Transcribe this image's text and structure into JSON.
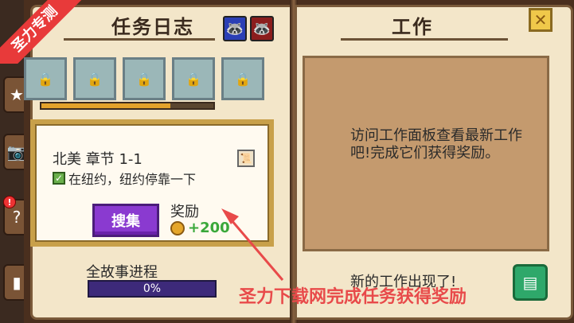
{
  "left_page": {
    "title": "任务日志",
    "portraits": [
      "blue-raccoon",
      "red-raccoon"
    ],
    "map_progress_percent": 75
  },
  "quest": {
    "title": "北美 章节 1-1",
    "task": "在纽约，纽约停靠一下",
    "collect_button": "搜集",
    "reward_label": "奖励",
    "reward_value": "+200"
  },
  "story_progress": {
    "label": "全故事进程",
    "value": "0%"
  },
  "right_page": {
    "title": "工作",
    "message": "访问工作面板查看最新工作吧!完成它们获得奖励。",
    "new_work": "新的工作出现了!"
  },
  "watermark": {
    "corner": "圣力专测",
    "caption": "圣力下载网完成任务获得奖励"
  },
  "colors": {
    "collect_button": "#8a3ad0",
    "reward_text": "#3aa83a",
    "story_bar": "#3d2a7a",
    "watermark": "#e84a4a"
  }
}
